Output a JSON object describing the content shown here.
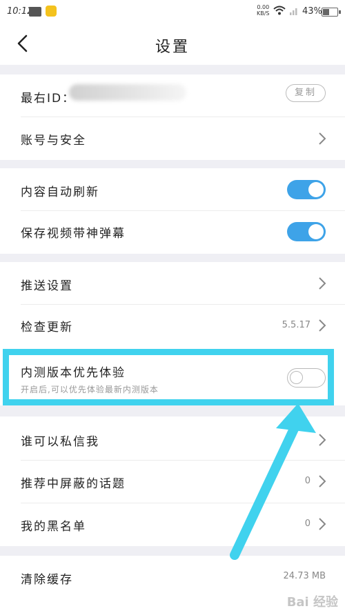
{
  "status_bar": {
    "time": "10:12",
    "speed_value": "0.00",
    "speed_unit": "KB/S",
    "battery": "43%",
    "battery_level": 0.43
  },
  "header": {
    "title": "设置"
  },
  "account": {
    "id_label": "最右ID：",
    "copy_label": "复制",
    "security_label": "账号与安全"
  },
  "content": {
    "auto_refresh_label": "内容自动刷新",
    "auto_refresh_on": true,
    "save_video_label": "保存视频带神弹幕",
    "save_video_on": true
  },
  "general": {
    "push_label": "推送设置",
    "update_label": "检查更新",
    "version": "5.5.17",
    "beta_label": "内测版本优先体验",
    "beta_desc": "开启后,可以优先体验最新内测版本",
    "beta_on": false
  },
  "privacy": {
    "messages_label": "谁可以私信我",
    "blocked_topics_label": "推荐中屏蔽的话题",
    "blocked_topics_count": "0",
    "blacklist_label": "我的黑名单",
    "blacklist_count": "0"
  },
  "storage": {
    "clear_cache_label": "清除缓存",
    "cache_size": "24.73 MB"
  },
  "watermark": "Bai 经验",
  "colors": {
    "accent": "#3ea3e8",
    "highlight": "#40d2ee",
    "section_gap": "#efeff4"
  }
}
